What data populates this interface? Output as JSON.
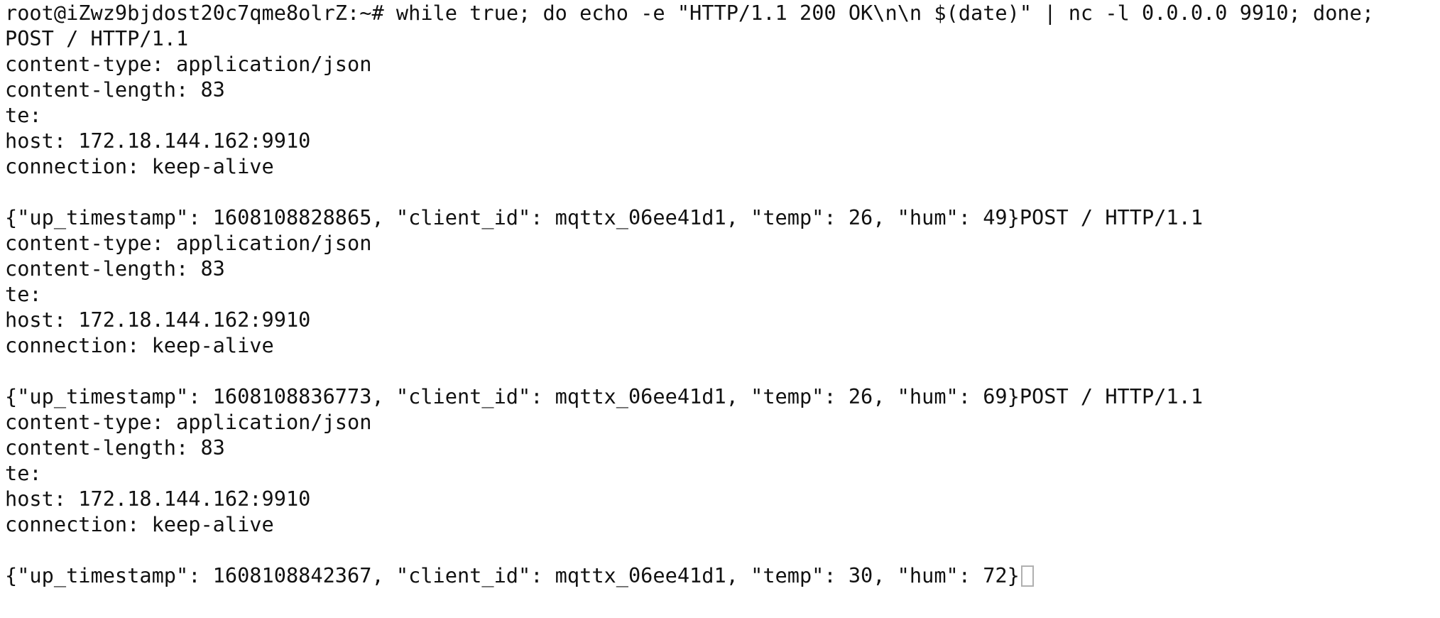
{
  "terminal": {
    "prompt": "root@iZwz9bjdost20c7qme8olrZ:~# ",
    "command": "while true; do echo -e \"HTTP/1.1 200 OK\\n\\n $(date)\" | nc -l 0.0.0.0 9910; done;",
    "lines": [
      "POST / HTTP/1.1",
      "content-type: application/json",
      "content-length: 83",
      "te:",
      "host: 172.18.144.162:9910",
      "connection: keep-alive",
      "",
      "{\"up_timestamp\": 1608108828865, \"client_id\": mqttx_06ee41d1, \"temp\": 26, \"hum\": 49}POST / HTTP/1.1",
      "content-type: application/json",
      "content-length: 83",
      "te:",
      "host: 172.18.144.162:9910",
      "connection: keep-alive",
      "",
      "{\"up_timestamp\": 1608108836773, \"client_id\": mqttx_06ee41d1, \"temp\": 26, \"hum\": 69}POST / HTTP/1.1",
      "content-type: application/json",
      "content-length: 83",
      "te:",
      "host: 172.18.144.162:9910",
      "connection: keep-alive",
      ""
    ],
    "last_line": "{\"up_timestamp\": 1608108842367, \"client_id\": mqttx_06ee41d1, \"temp\": 30, \"hum\": 72}"
  }
}
